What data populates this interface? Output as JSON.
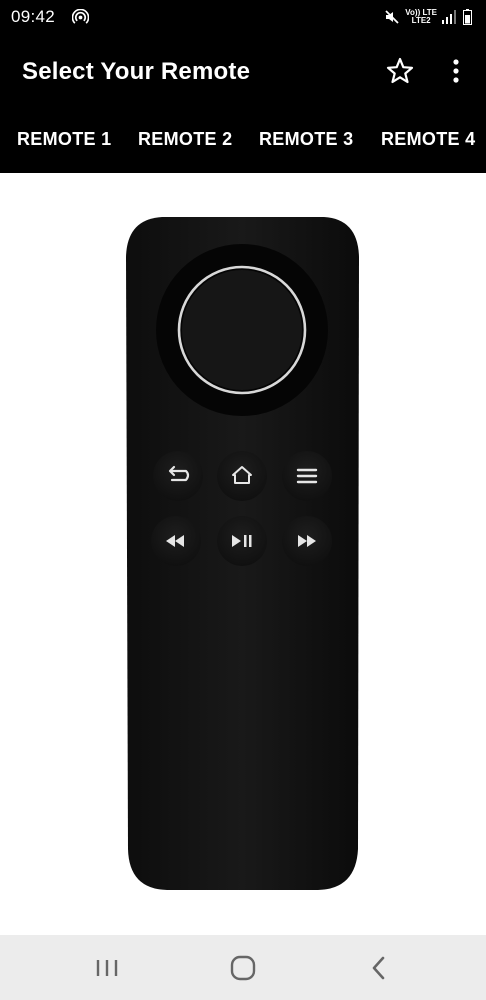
{
  "status_bar": {
    "time": "09:42",
    "network_top": "Vo)) LTE",
    "network_bottom": "LTE2"
  },
  "app_bar": {
    "title": "Select Your Remote",
    "icons": [
      "star-icon",
      "more-vert-icon"
    ]
  },
  "tabs": [
    {
      "label": "REMOTE 1"
    },
    {
      "label": "REMOTE 2"
    },
    {
      "label": "REMOTE 3"
    },
    {
      "label": "REMOTE 4"
    }
  ],
  "remote": {
    "buttons": [
      "dpad-ring",
      "dpad-select",
      "back-icon",
      "home-icon",
      "menu-icon",
      "rewind-icon",
      "play-pause-icon",
      "fast-forward-icon"
    ]
  },
  "nav_bar": {
    "icons": [
      "recent-apps-icon",
      "home-nav-icon",
      "back-nav-icon"
    ]
  },
  "colors": {
    "bar": "#000000",
    "remote_body": "#141414",
    "nav_bar": "#ececec"
  }
}
